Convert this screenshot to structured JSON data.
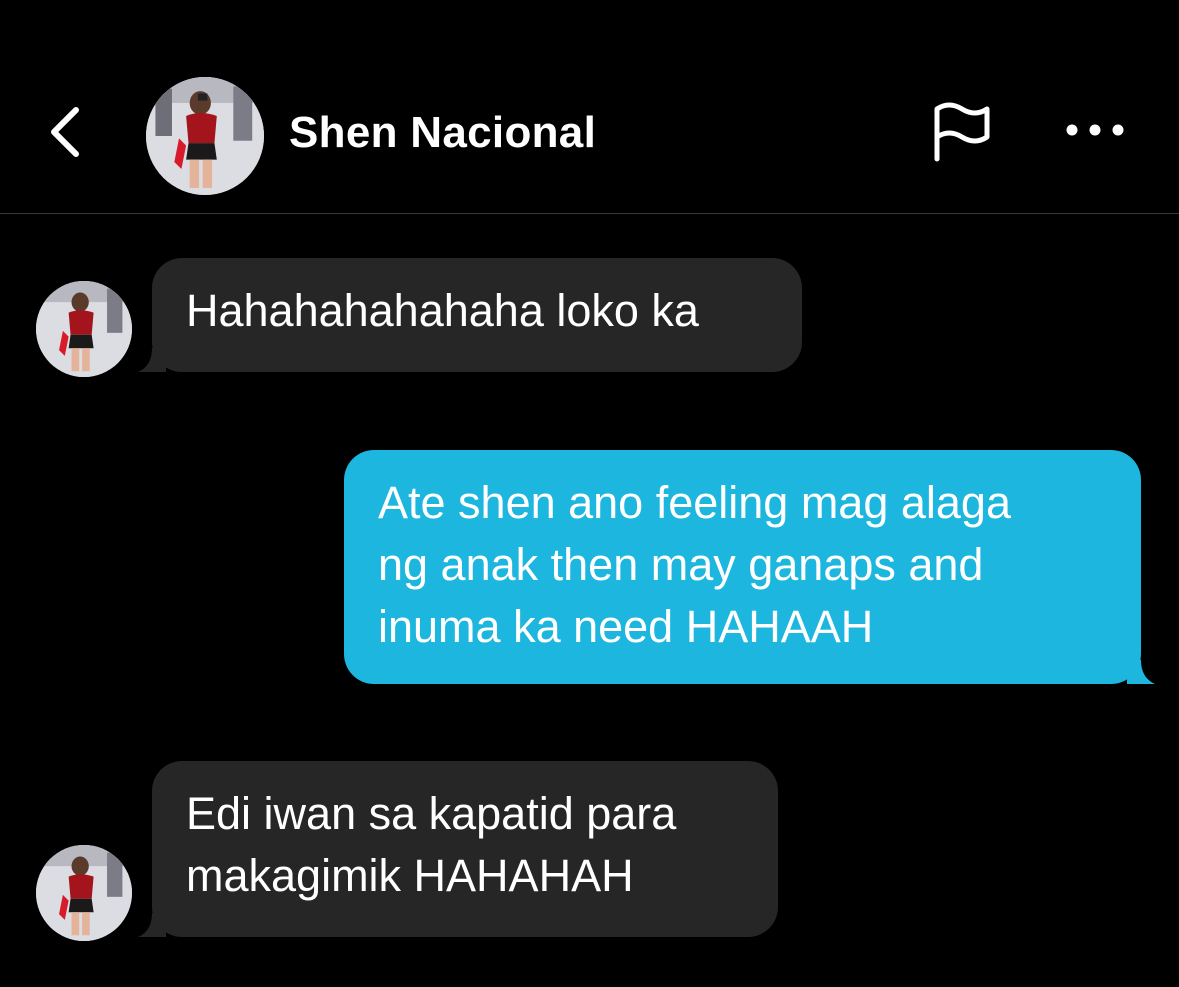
{
  "header": {
    "contact_name": "Shen Nacional",
    "icons": [
      "chevron-left-icon",
      "avatar",
      "flag-icon",
      "more-horizontal-icon"
    ]
  },
  "messages": [
    {
      "direction": "incoming",
      "text": "Hahahahahahaha loko ka"
    },
    {
      "direction": "outgoing",
      "lines": [
        "Ate shen ano feeling mag alaga",
        "ng anak then may ganaps and",
        "inuma ka need HAHAAH"
      ]
    },
    {
      "direction": "incoming",
      "lines": [
        "Edi iwan sa kapatid para",
        "makagimik HAHAHAH"
      ]
    }
  ],
  "colors": {
    "background": "#000000",
    "incoming_bubble": "#262626",
    "outgoing_bubble": "#1cb6de",
    "text": "#ffffff",
    "divider": "#3a3a3a"
  }
}
